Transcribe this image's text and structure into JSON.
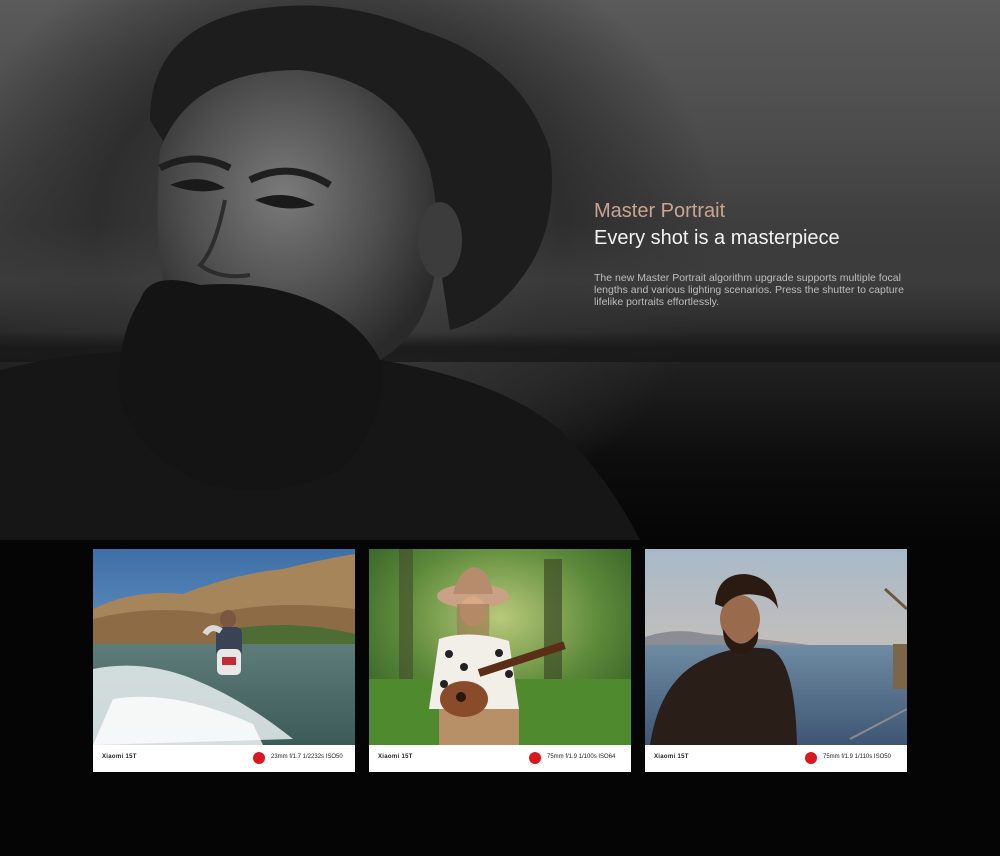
{
  "hero": {
    "kicker": "Master Portrait",
    "headline": "Every shot is a masterpiece",
    "description": "The new Master Portrait algorithm upgrade supports multiple focal lengths and various lighting scenarios. Press the shutter to capture lifelike portraits effortlessly."
  },
  "samples": [
    {
      "brand": "Xiaomi 15T",
      "specs": "23mm  f/1.7  1/2232s  ISO50"
    },
    {
      "brand": "Xiaomi 15T",
      "specs": "75mm  f/1.9  1/100s  ISO64"
    },
    {
      "brand": "Xiaomi 15T",
      "specs": "75mm  f/1.9  1/110s  ISO50"
    }
  ],
  "colors": {
    "accent": "#c9a593",
    "leica_red": "#d8171f",
    "background": "#050505"
  }
}
